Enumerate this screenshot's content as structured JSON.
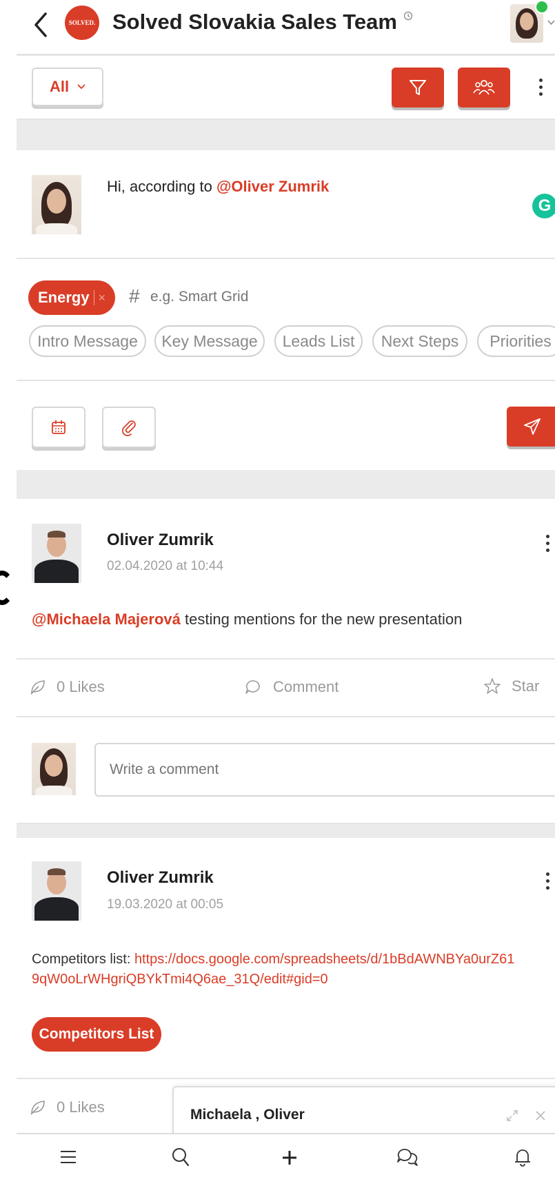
{
  "header": {
    "back_icon": "chevron-left-icon",
    "logo_text": "SOLVED.",
    "title": "Solved Slovakia Sales Team",
    "title_icon": "clock-icon",
    "online_color": "#2dbf4a"
  },
  "toolbar": {
    "filter_selected": "All",
    "filter_icon": "funnel-icon",
    "members_icon": "users-icon",
    "more_icon": "kebab-icon"
  },
  "composer": {
    "text_prefix": "Hi, according to ",
    "text_mention": "@Oliver Zumrik",
    "grammarly_letter": "G",
    "tag_chip": "Energy",
    "tag_chip_remove": "×",
    "hash": "#",
    "tag_placeholder": "e.g. Smart Grid",
    "quick_tags": [
      "Intro Message",
      "Key Message",
      "Leads List",
      "Next Steps",
      "Priorities"
    ]
  },
  "posts": [
    {
      "author": "Oliver Zumrik",
      "timestamp": "02.04.2020 at 10:44",
      "mention": "@Michaela Majerová",
      "text": " testing mentions for the new presentation",
      "likes": "0 Likes",
      "comment": "Comment",
      "star": "Star",
      "comment_placeholder": "Write a comment"
    },
    {
      "author": "Oliver Zumrik",
      "timestamp": "19.03.2020 at 00:05",
      "text_prefix": "Competitors list: ",
      "link_line1": "https://docs.google.com/spreadsheets/d/1bBdAWNBYa0urZ61",
      "link_line2": "9qW0oLrWHgriQBYkTmi4Q6ae_31Q/edit#gid=0",
      "tag": "Competitors List",
      "likes": "0 Likes"
    }
  ],
  "chat_popup": {
    "title": "Michaela , Oliver",
    "expand_icon": "expand-icon",
    "close_icon": "close-icon"
  },
  "bottom_nav": [
    "menu-icon",
    "search-icon",
    "plus-icon",
    "chat-icon",
    "bell-icon"
  ],
  "colors": {
    "accent": "#d93d27",
    "text": "#1d1d1d",
    "muted": "#9a9a9a"
  }
}
